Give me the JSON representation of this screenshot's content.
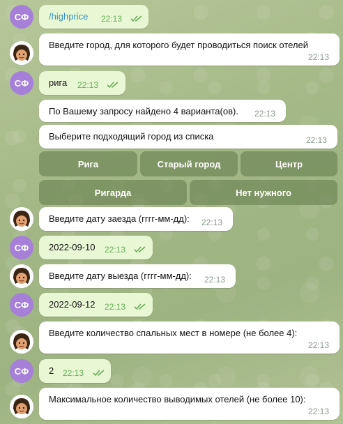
{
  "messages": [
    {
      "from": "user",
      "avatar": "СФ",
      "text": "/highprice",
      "time": "22:13",
      "is_command": true
    },
    {
      "from": "bot",
      "text": "Введите город, для которого будет проводиться поиск отелей",
      "time": "22:13"
    },
    {
      "from": "user",
      "avatar": "СФ",
      "text": "рига",
      "time": "22:13"
    },
    {
      "from": "bot",
      "text": "По Вашему запросу найдено 4 варианта(ов).",
      "time": "22:13"
    },
    {
      "from": "bot",
      "text": "Выберите подходящий город из списка",
      "time": "22:13"
    },
    {
      "from": "bot",
      "text": "Введите дату заезда (гггг-мм-дд):",
      "time": "22:13"
    },
    {
      "from": "user",
      "avatar": "СФ",
      "text": "2022-09-10",
      "time": "22:13"
    },
    {
      "from": "bot",
      "text": "Введите дату выезда (гггг-мм-дд):",
      "time": "22:13"
    },
    {
      "from": "user",
      "avatar": "СФ",
      "text": "2022-09-12",
      "time": "22:13"
    },
    {
      "from": "bot",
      "text": "Введите количество спальных мест в номере (не более 4):",
      "time": "22:13"
    },
    {
      "from": "user",
      "avatar": "СФ",
      "text": "2",
      "time": "22:13"
    },
    {
      "from": "bot",
      "text": "Максимальное количество выводимых отелей (не более 10):",
      "time": "22:13"
    }
  ],
  "keyboard": {
    "row1": [
      "Рига",
      "Старый город",
      "Центр"
    ],
    "row2": [
      "Ригарда",
      "Нет нужного"
    ]
  },
  "colors": {
    "outgoing_bubble": "#e8f8d4",
    "incoming_bubble": "#ffffff",
    "user_avatar": "#a680d8",
    "command_link": "#3a8fc4",
    "read_ticks": "#6bab5a",
    "keyboard_button": "#6b8250"
  },
  "icons": {
    "read_status": "double-check-icon",
    "bot_avatar": "cartoon-girl-avatar-icon"
  }
}
